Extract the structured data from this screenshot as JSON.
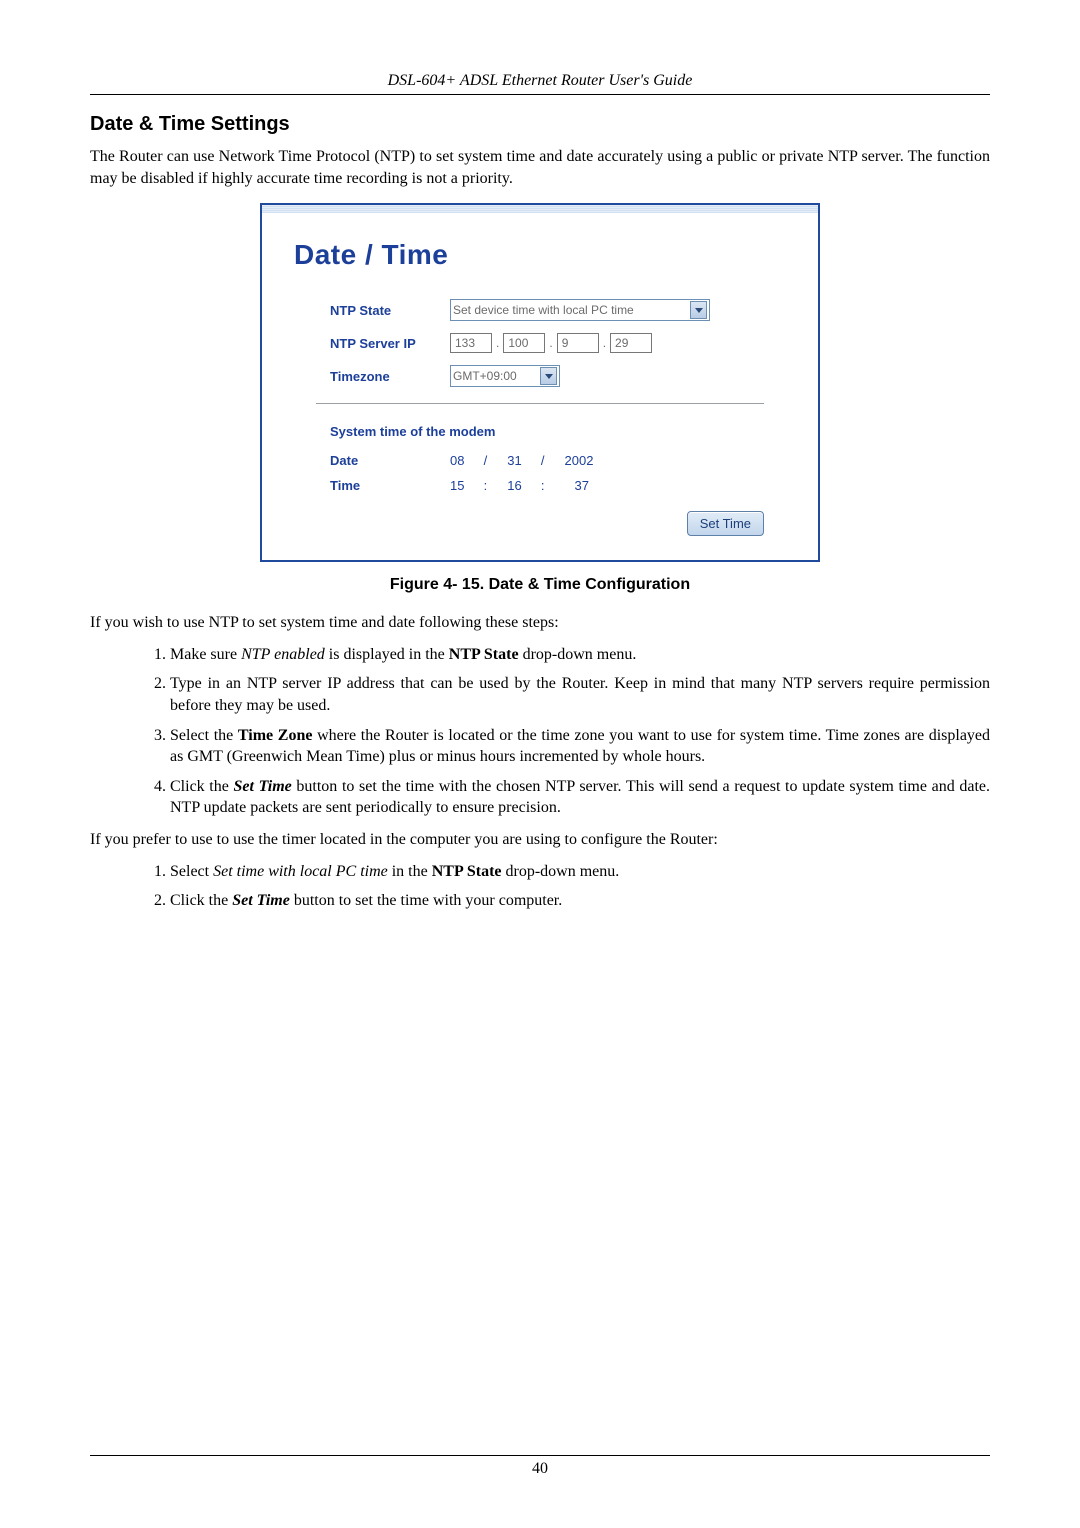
{
  "header": "DSL-604+ ADSL Ethernet Router User's Guide",
  "section_title": "Date & Time Settings",
  "intro": "The Router can use Network Time Protocol (NTP) to set system time and date accurately using a public or private NTP server. The function may be disabled if highly accurate time recording is not a priority.",
  "panel": {
    "title": "Date / Time",
    "ntp_state_label": "NTP State",
    "ntp_state_value": "Set device time with local PC time",
    "ntp_server_label": "NTP Server IP",
    "ip": {
      "a": "133",
      "b": "100",
      "c": "9",
      "d": "29"
    },
    "timezone_label": "Timezone",
    "timezone_value": "GMT+09:00",
    "system_time_heading": "System time of the modem",
    "date_label": "Date",
    "date": {
      "dd": "08",
      "mm": "31",
      "yyyy": "2002"
    },
    "time_label": "Time",
    "time": {
      "hh": "15",
      "mm": "16",
      "ss": "37"
    },
    "set_time_btn": "Set Time"
  },
  "figure_caption": "Figure 4- 15. Date & Time Configuration",
  "steps_intro": "If you wish to use NTP to set system time and date following these steps:",
  "steps_a": {
    "s1_a": "Make sure ",
    "s1_b": "NTP enabled",
    "s1_c": " is displayed in the ",
    "s1_d": "NTP State",
    "s1_e": " drop-down menu.",
    "s2": "Type in an NTP server IP address that can be used by the Router. Keep in mind that many NTP servers require permission before they may be used.",
    "s3_a": "Select the ",
    "s3_b": "Time Zone",
    "s3_c": " where the Router is located or the time zone you want to use for system time. Time zones are displayed as GMT (Greenwich Mean Time) plus or minus hours incremented by whole hours.",
    "s4_a": "Click the ",
    "s4_b": "Set Time",
    "s4_c": " button to set the time with the chosen NTP server. This will send a request to update system time and date. NTP update packets are sent periodically to ensure precision."
  },
  "steps_b_intro": "If you prefer to use to use the timer located in the computer you are using to configure the Router:",
  "steps_b": {
    "s1_a": "Select ",
    "s1_b": "Set time with local PC time",
    "s1_c": " in the ",
    "s1_d": "NTP State",
    "s1_e": " drop-down menu.",
    "s2_a": "Click the ",
    "s2_b": "Set Time",
    "s2_c": " button to set the time with your computer."
  },
  "page_number": "40"
}
